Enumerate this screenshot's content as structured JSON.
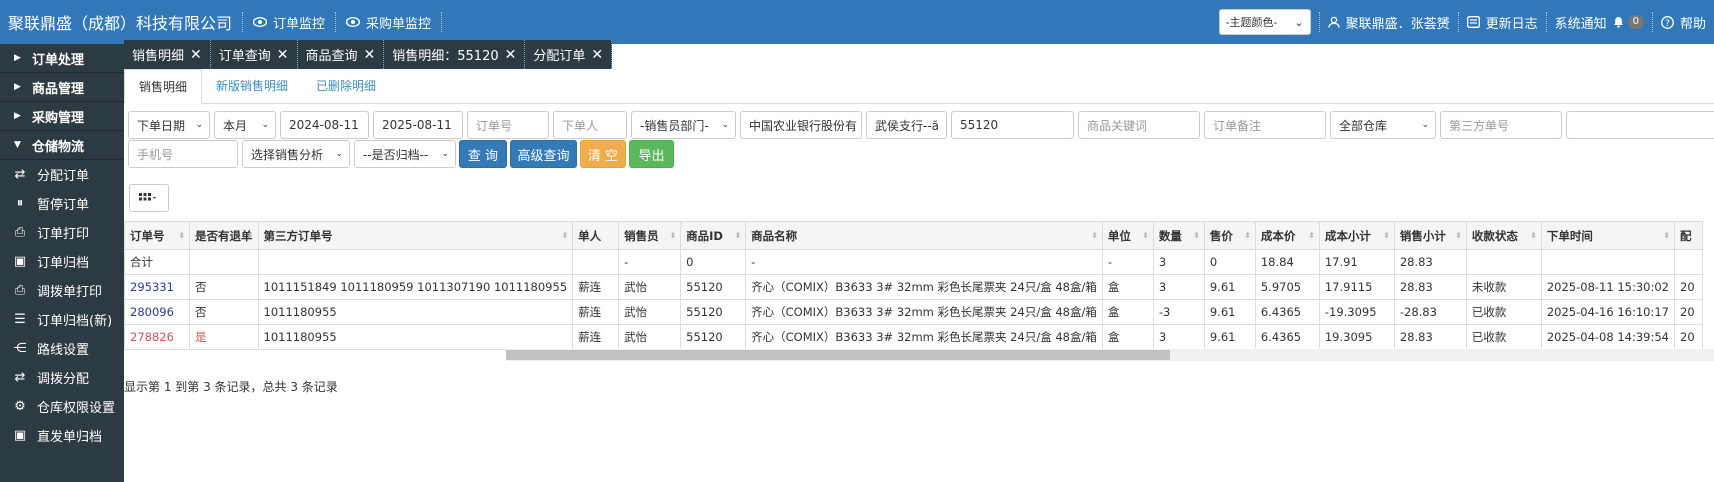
{
  "header": {
    "company": "聚联鼎盛（成都）科技有限公司",
    "order_monitor": "订单监控",
    "po_monitor": "采购单监控",
    "theme_select": "-主题颜色-",
    "user": "聚联鼎盛．张荟赟",
    "changelog": "更新日志",
    "notify": "系统通知",
    "notify_count": "0",
    "help": "帮助"
  },
  "sidebar": {
    "groups": [
      "订单处理",
      "商品管理",
      "采购管理",
      "仓储物流"
    ],
    "items": [
      "分配订单",
      "暂停订单",
      "订单打印",
      "订单归档",
      "调拨单打印",
      "订单归档(新)",
      "路线设置",
      "调拨分配",
      "仓库权限设置",
      "直发单归档"
    ]
  },
  "tabs": [
    "销售明细",
    "订单查询",
    "商品查询",
    "销售明细：55120",
    "分配订单"
  ],
  "subtabs": [
    "销售明细",
    "新版销售明细",
    "已删除明细"
  ],
  "filters": {
    "date_type": "下单日期",
    "period": "本月",
    "date_from": "2024-08-11",
    "date_to": "2025-08-11",
    "order_no_ph": "订单号",
    "orderer_ph": "下单人",
    "dept": "-销售员部门-",
    "bank": "中国农业银行股份有",
    "branch": "武侯支行--ã",
    "product_id": "55120",
    "keyword_ph": "商品关键词",
    "remark_ph": "订单备注",
    "warehouse": "全部仓库",
    "third_party_ph": "第三方单号",
    "phone_ph": "手机号",
    "analysis": "选择销售分析",
    "archived": "--是否归档--",
    "btn_search": "查 询",
    "btn_advanced": "高级查询",
    "btn_clear": "清 空",
    "btn_export": "导出"
  },
  "colors": {
    "topbar": "#3278b9",
    "sidebar": "#2c3b41",
    "btn_primary": "#337ab7",
    "btn_warning": "#f0ad4e",
    "btn_success": "#5cb85c"
  },
  "table": {
    "headers": [
      "订单号",
      "是否有退单",
      "第三方订单号",
      "单人",
      "销售员",
      "商品ID",
      "商品名称",
      "单位",
      "数量",
      "售价",
      "成本价",
      "成本小计",
      "销售小计",
      "收款状态",
      "下单时间",
      "配"
    ],
    "total_row": [
      "合计",
      "",
      "",
      "",
      "-",
      "0",
      "-",
      "-",
      "3",
      "0",
      "18.84",
      "17.91",
      "28.83",
      "",
      "",
      ""
    ],
    "rows": [
      [
        "295331",
        "否",
        "1011151849 1011180959 1011307190 1011180955",
        "薪连",
        "武怡",
        "55120",
        "齐心（COMIX）B3633 3# 32mm 彩色长尾票夹 24只/盒 48盒/箱",
        "盒",
        "3",
        "9.61",
        "5.9705",
        "17.9115",
        "28.83",
        "未收款",
        "2025-08-11 15:30:02",
        "20"
      ],
      [
        "280096",
        "否",
        "1011180955",
        "薪连",
        "武怡",
        "55120",
        "齐心（COMIX）B3633 3# 32mm 彩色长尾票夹 24只/盒 48盒/箱",
        "盒",
        "-3",
        "9.61",
        "6.4365",
        "-19.3095",
        "-28.83",
        "已收款",
        "2025-04-16 16:10:17",
        "20"
      ],
      [
        "278826",
        "是",
        "1011180955",
        "薪连",
        "武怡",
        "55120",
        "齐心（COMIX）B3633 3# 32mm 彩色长尾票夹 24只/盒 48盒/箱",
        "盒",
        "3",
        "9.61",
        "6.4365",
        "19.3095",
        "28.83",
        "已收款",
        "2025-04-08 14:39:54",
        "20"
      ]
    ]
  },
  "footer": "显示第 1 到第 3 条记录，总共 3 条记录"
}
